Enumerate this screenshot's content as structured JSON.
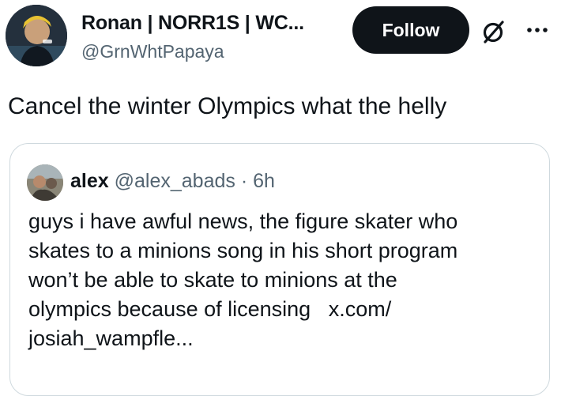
{
  "tweet": {
    "author": {
      "name": "Ronan | NORR1S | WC...",
      "handle": "@GrnWhtPapaya"
    },
    "follow_label": "Follow",
    "text": "Cancel the winter Olympics what the helly"
  },
  "quote": {
    "author": {
      "name": "alex",
      "handle": "@alex_abads",
      "separator": "·",
      "time": "6h"
    },
    "lines": [
      "guys i have awful news, the figure skater who",
      "skates to a minions song in his short program",
      "won’t be able to skate to minions at the",
      "olympics because of licensing"
    ],
    "link_line1": "x.com/",
    "link_line2": "josiah_wampfle..."
  },
  "icons": {
    "grok": "grok-slash-circle-icon",
    "more": "more-horizontal-icon"
  },
  "colors": {
    "text_primary": "#0f1419",
    "text_secondary": "#536471",
    "border": "#cfd9de",
    "follow_button_bg": "#0f1419"
  }
}
